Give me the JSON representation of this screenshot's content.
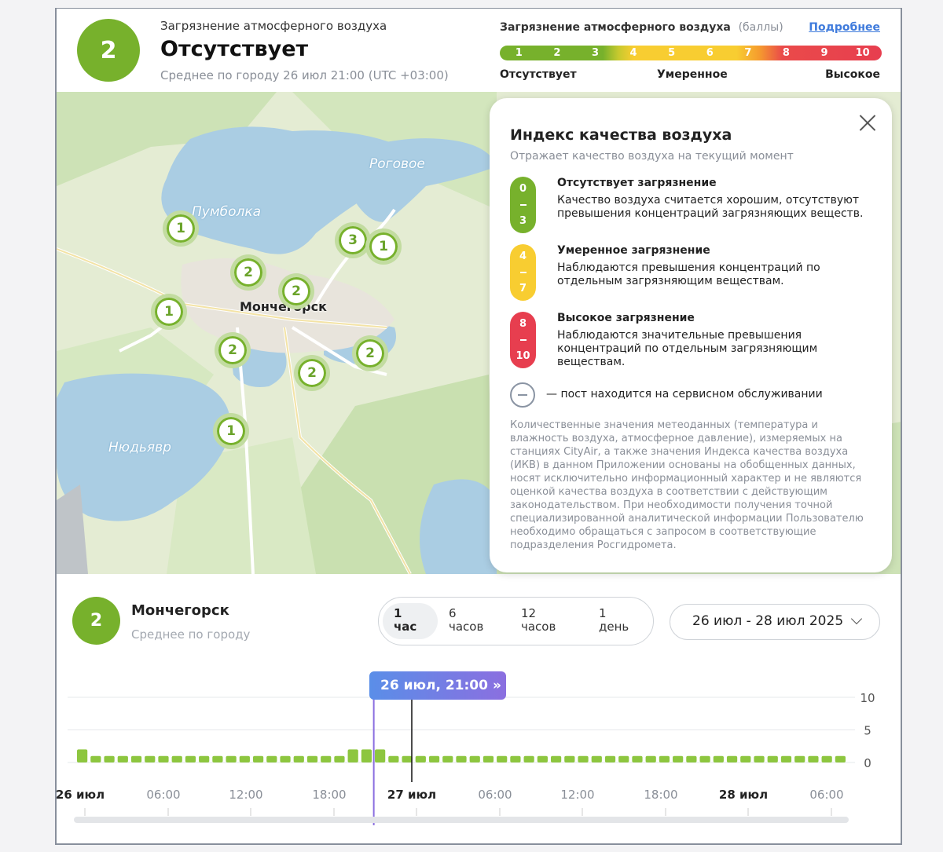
{
  "header": {
    "index_value": "2",
    "caption": "Загрязнение атмосферного воздуха",
    "status": "Отсутствует",
    "subtitle": "Среднее по городу 26 июл 21:00 (UTC +03:00)",
    "scale_title": "Загрязнение атмосферного воздуха",
    "scale_units": "(баллы)",
    "more_link": "Подробнее",
    "scale_numbers": [
      "1",
      "2",
      "3",
      "4",
      "5",
      "6",
      "7",
      "8",
      "9",
      "10"
    ],
    "scale_labels": {
      "low": "Отсутствует",
      "mid": "Умеренное",
      "high": "Высокое"
    }
  },
  "colors": {
    "good": "#77b12c",
    "moderate": "#f8cd31",
    "high": "#e73e4f",
    "accent": "#3f7bdc"
  },
  "map": {
    "labels": {
      "lake1": "Пумболка",
      "lake2": "Роговое",
      "lake3": "Нюдьявр",
      "city": "Мончегорск"
    },
    "markers": [
      "1",
      "2",
      "2",
      "1",
      "3",
      "1",
      "2",
      "2",
      "2",
      "1"
    ]
  },
  "popup": {
    "title": "Индекс качества воздуха",
    "subtitle": "Отражает качество воздуха на текущий момент",
    "levels": [
      {
        "from": "0",
        "to": "3",
        "title": "Отсутствует загрязнение",
        "text": "Качество воздуха считается хорошим, отсутствуют превышения концентраций загрязняющих веществ."
      },
      {
        "from": "4",
        "to": "7",
        "title": "Умеренное загрязнение",
        "text": "Наблюдаются превышения концентраций по отдельным загрязняющим веществам."
      },
      {
        "from": "8",
        "to": "10",
        "title": "Высокое загрязнение",
        "text": "Наблюдаются значительные превышения концентраций по отдельным загрязняющим веществам."
      }
    ],
    "service_note": "— пост находится на сервисном обслуживании",
    "disclaimer": "Количественные значения метеоданных (температура и влажность воздуха, атмосферное давление), измеряемых на станциях CityAir, а также значения Индекса качества воздуха (ИКВ) в данном Приложении основаны на обобщенных данных, носят исключительно информационный характер и не являются оценкой качества воздуха в соответствии с действующим законодательством. При необходимости получения точной специализированной аналитической информации Пользователю необходимо обращаться с запросом в соответствующие подразделения Росгидромета."
  },
  "bottom": {
    "city_index": "2",
    "city_name": "Мончегорск",
    "city_sub": "Среднее по городу",
    "tabs": [
      {
        "num": "1",
        "unit": "час"
      },
      {
        "num": "6",
        "unit": "часов"
      },
      {
        "num": "12",
        "unit": "часов"
      },
      {
        "num": "1",
        "unit": "день"
      }
    ],
    "date_range": "26 июл - 28 июл 2025",
    "tooltip": "26 июл, 21:00",
    "tooltip_icon": "double-chevron-right-icon"
  },
  "chart_data": {
    "type": "bar",
    "ylim": [
      0,
      10
    ],
    "y_ticks": [
      "10",
      "5",
      "0"
    ],
    "x_ticks": [
      "26 июл",
      "06:00",
      "12:00",
      "18:00",
      "27 июл",
      "06:00",
      "12:00",
      "18:00",
      "28 июл",
      "06:00"
    ],
    "values": [
      2,
      1,
      1,
      1,
      1,
      1,
      1,
      1,
      1,
      1,
      1,
      1,
      1,
      1,
      1,
      1,
      1,
      1,
      1,
      1,
      2,
      2,
      2,
      1,
      1,
      1,
      1,
      1,
      1,
      1,
      1,
      1,
      1,
      1,
      1,
      1,
      1,
      1,
      1,
      1,
      1,
      1,
      1,
      1,
      1,
      1,
      1,
      1,
      1,
      1,
      1,
      1,
      1,
      1,
      1,
      1,
      1
    ],
    "selected": "26 июл, 21:00"
  }
}
